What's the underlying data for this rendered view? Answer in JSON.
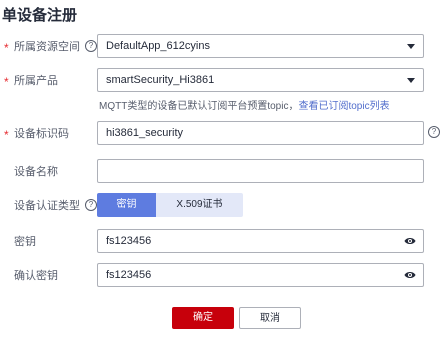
{
  "page": {
    "title": "单设备注册"
  },
  "form": {
    "resource_space": {
      "label": "所属资源空间",
      "required_mark": "*",
      "help": "?",
      "value": "DefaultApp_612cyins"
    },
    "product": {
      "label": "所属产品",
      "required_mark": "*",
      "value": "smartSecurity_Hi3861",
      "hint_text": "MQTT类型的设备已默认订阅平台预置topic，",
      "hint_link": "查看已订阅topic列表"
    },
    "device_identifier": {
      "label": "设备标识码",
      "required_mark": "*",
      "value": "hi3861_security",
      "help": "?"
    },
    "device_name": {
      "label": "设备名称",
      "value": ""
    },
    "auth_type": {
      "label": "设备认证类型",
      "help": "?",
      "options": [
        "密钥",
        "X.509证书"
      ],
      "selected": "密钥"
    },
    "secret": {
      "label": "密钥",
      "value": "fs123456"
    },
    "confirm_secret": {
      "label": "确认密钥",
      "value": "fs123456"
    }
  },
  "actions": {
    "confirm_label": "确定",
    "cancel_label": "取消"
  },
  "colors": {
    "primary_button": "#c7000b",
    "segment_active": "#5e7ce0",
    "segment_inactive": "#e3e8f8",
    "link": "#526ecc",
    "required": "#e62d32"
  }
}
